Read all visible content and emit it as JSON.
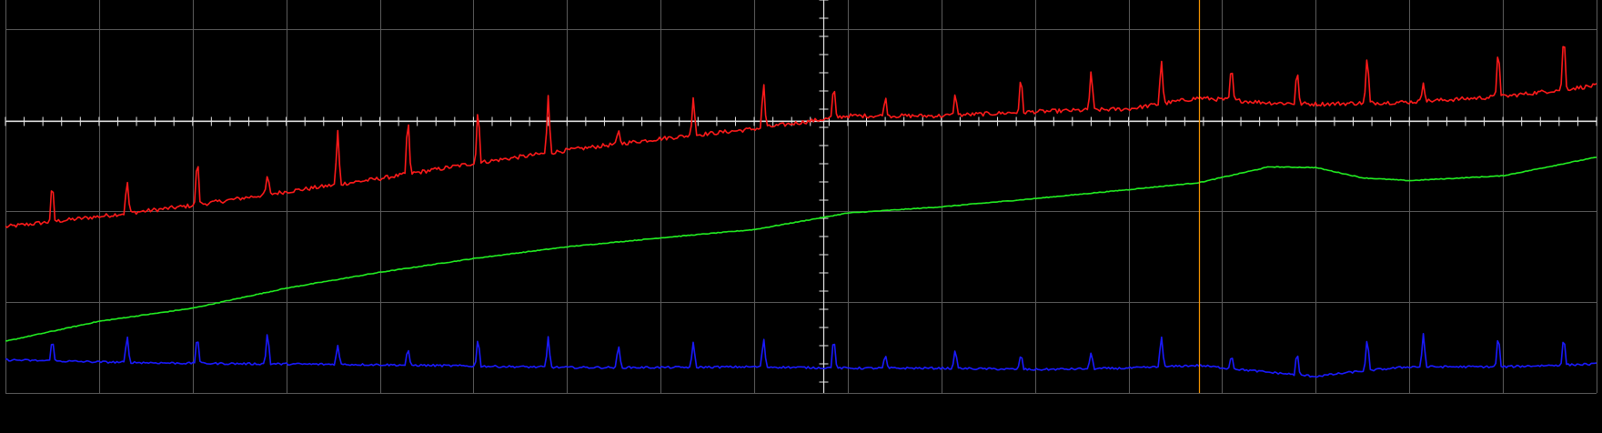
{
  "app": {
    "name": "oscilloscope-trace-view"
  },
  "chart_data": {
    "type": "line",
    "title": "",
    "xlabel": "",
    "ylabel": "",
    "grid": true,
    "grid_divisions": {
      "x": 17,
      "y": 4
    },
    "xlim": [
      0,
      17
    ],
    "ylim": [
      -1.0,
      4.7
    ],
    "cursor": {
      "x": 12.75,
      "color": "#ff9900"
    },
    "colors": {
      "background": "#000000",
      "grid": "#5a5a5a",
      "axes": "#e6e6e6",
      "ch1": "#ff1a1a",
      "ch2": "#22ee22",
      "ch3": "#1a1aff"
    },
    "series": [
      {
        "color": "#ff1a1a",
        "baseline_points": [
          [
            0.0,
            1.41
          ],
          [
            1.0,
            1.56
          ],
          [
            2.0,
            1.72
          ],
          [
            3.0,
            1.92
          ],
          [
            4.0,
            2.11
          ],
          [
            5.0,
            2.33
          ],
          [
            6.0,
            2.52
          ],
          [
            7.0,
            2.69
          ],
          [
            8.0,
            2.83
          ],
          [
            9.0,
            3.02
          ],
          [
            10.0,
            3.02
          ],
          [
            11.0,
            3.08
          ],
          [
            12.0,
            3.12
          ],
          [
            12.75,
            3.28
          ],
          [
            13.5,
            3.21
          ],
          [
            14.0,
            3.19
          ],
          [
            15.0,
            3.22
          ],
          [
            16.0,
            3.3
          ],
          [
            17.0,
            3.46
          ]
        ],
        "spikes": [
          [
            0.5,
            0.6
          ],
          [
            1.3,
            0.5
          ],
          [
            2.05,
            0.75
          ],
          [
            2.8,
            0.3
          ],
          [
            3.55,
            0.8
          ],
          [
            4.3,
            0.9
          ],
          [
            5.05,
            0.9
          ],
          [
            5.8,
            0.85
          ],
          [
            6.55,
            0.2
          ],
          [
            7.35,
            0.6
          ],
          [
            8.1,
            0.7
          ],
          [
            8.85,
            0.5
          ],
          [
            9.4,
            0.3
          ],
          [
            10.15,
            0.35
          ],
          [
            10.85,
            0.55
          ],
          [
            11.6,
            0.6
          ],
          [
            12.35,
            0.7
          ],
          [
            13.1,
            0.55
          ],
          [
            13.8,
            0.55
          ],
          [
            14.55,
            0.75
          ],
          [
            15.15,
            0.3
          ],
          [
            15.95,
            0.8
          ],
          [
            16.65,
            0.9
          ]
        ],
        "noise": 0.03
      },
      {
        "color": "#22ee22",
        "baseline_points": [
          [
            0.0,
            -0.25
          ],
          [
            1.0,
            0.04
          ],
          [
            2.0,
            0.23
          ],
          [
            3.0,
            0.52
          ],
          [
            4.0,
            0.75
          ],
          [
            5.0,
            0.95
          ],
          [
            6.0,
            1.12
          ],
          [
            7.0,
            1.25
          ],
          [
            8.0,
            1.37
          ],
          [
            9.0,
            1.61
          ],
          [
            10.0,
            1.7
          ],
          [
            11.0,
            1.82
          ],
          [
            12.0,
            1.95
          ],
          [
            12.75,
            2.05
          ],
          [
            13.5,
            2.28
          ],
          [
            14.0,
            2.27
          ],
          [
            14.5,
            2.12
          ],
          [
            15.0,
            2.08
          ],
          [
            16.0,
            2.15
          ],
          [
            17.0,
            2.42
          ]
        ],
        "spikes": [],
        "noise": 0.005
      },
      {
        "color": "#1a1aff",
        "baseline_points": [
          [
            0.0,
            -0.52
          ],
          [
            1.0,
            -0.55
          ],
          [
            2.0,
            -0.57
          ],
          [
            3.0,
            -0.58
          ],
          [
            4.0,
            -0.59
          ],
          [
            5.0,
            -0.61
          ],
          [
            6.0,
            -0.63
          ],
          [
            7.0,
            -0.63
          ],
          [
            8.0,
            -0.62
          ],
          [
            9.0,
            -0.64
          ],
          [
            10.0,
            -0.64
          ],
          [
            11.0,
            -0.66
          ],
          [
            12.0,
            -0.64
          ],
          [
            12.75,
            -0.6
          ],
          [
            13.5,
            -0.7
          ],
          [
            14.0,
            -0.76
          ],
          [
            14.5,
            -0.68
          ],
          [
            15.0,
            -0.62
          ],
          [
            16.0,
            -0.62
          ],
          [
            17.0,
            -0.58
          ]
        ],
        "spikes": [
          [
            0.5,
            0.35
          ],
          [
            1.3,
            0.4
          ],
          [
            2.05,
            0.45
          ],
          [
            2.8,
            0.5
          ],
          [
            3.55,
            0.3
          ],
          [
            4.3,
            0.25
          ],
          [
            5.05,
            0.45
          ],
          [
            5.8,
            0.45
          ],
          [
            6.55,
            0.35
          ],
          [
            7.35,
            0.38
          ],
          [
            8.1,
            0.45
          ],
          [
            8.85,
            0.5
          ],
          [
            9.4,
            0.2
          ],
          [
            10.15,
            0.3
          ],
          [
            10.85,
            0.25
          ],
          [
            11.6,
            0.25
          ],
          [
            12.35,
            0.5
          ],
          [
            13.1,
            0.22
          ],
          [
            13.8,
            0.35
          ],
          [
            14.55,
            0.5
          ],
          [
            15.15,
            0.5
          ],
          [
            15.95,
            0.5
          ],
          [
            16.65,
            0.45
          ]
        ],
        "noise": 0.015
      }
    ]
  }
}
